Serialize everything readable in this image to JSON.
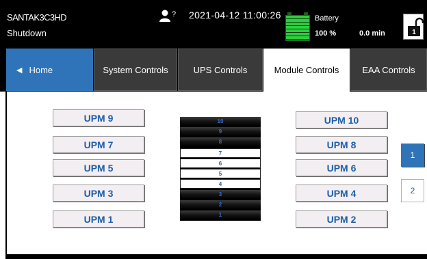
{
  "header": {
    "device_name": "SANTAK3C3HD",
    "status": "Shutdown",
    "user_badge": "?",
    "datetime": "2021-04-12 11:00:26",
    "battery_label": "Battery",
    "battery_percent": "100 %",
    "battery_runtime": "0.0 min",
    "lock_level": "1"
  },
  "tabs": {
    "home": "Home",
    "system_controls": "System Controls",
    "ups_controls": "UPS Controls",
    "module_controls": "Module Controls",
    "eaa_controls": "EAA Controls"
  },
  "upm_buttons": {
    "left": [
      "UPM 9",
      "UPM 7",
      "UPM 5",
      "UPM 3",
      "UPM 1"
    ],
    "right": [
      "UPM 10",
      "UPM 8",
      "UPM 6",
      "UPM 4",
      "UPM 2"
    ]
  },
  "module_stack": {
    "slots": [
      {
        "label": "10",
        "state": "empty"
      },
      {
        "label": "9",
        "state": "empty"
      },
      {
        "label": "8",
        "state": "empty"
      },
      {
        "label": "7",
        "state": "filled"
      },
      {
        "label": "6",
        "state": "filled"
      },
      {
        "label": "5",
        "state": "filled"
      },
      {
        "label": "4",
        "state": "filled"
      },
      {
        "label": "3",
        "state": "empty"
      },
      {
        "label": "2",
        "state": "empty"
      },
      {
        "label": "1",
        "state": "empty"
      }
    ]
  },
  "pagination": {
    "page1": "1",
    "page2": "2",
    "current": "1"
  },
  "icons": {
    "home_arrow": "left-triangle-icon",
    "user": "user-icon",
    "battery": "battery-icon",
    "lock": "unlocked-padlock-icon"
  },
  "colors": {
    "accent_blue": "#2f74b8",
    "label_blue": "#1f5fa8",
    "battery_green": "#2ecc40"
  }
}
